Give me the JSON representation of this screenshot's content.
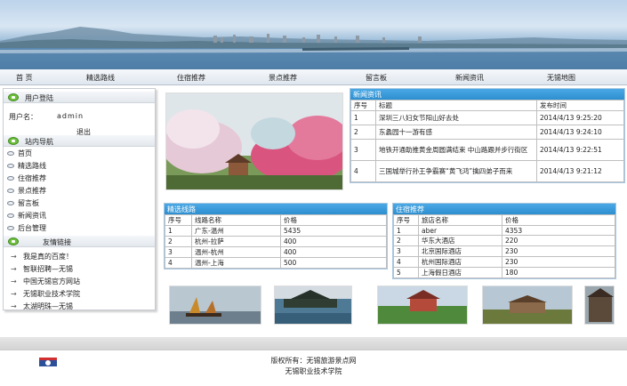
{
  "nav": [
    "首 页",
    "精选路线",
    "住宿推荐",
    "景点推荐",
    "留言板",
    "新闻资讯",
    "无锡地图"
  ],
  "sidebar": {
    "user_title": "用户登陆",
    "user_label": "用户名：",
    "user_name": "admin",
    "logout": "退出",
    "site_nav_title": "站内导航",
    "site_nav": [
      "首页",
      "精选路线",
      "住宿推荐",
      "景点推荐",
      "留言板",
      "新闻资讯",
      "后台管理"
    ],
    "links_title": "友情链接",
    "links": [
      "我是真的百度！",
      "智联招聘—无锡",
      "中国无锡官方网站",
      "无锡职业技术学院",
      "太湖明珠—无锡"
    ]
  },
  "news": {
    "title": "新闻资讯",
    "headers": [
      "序号",
      "标题",
      "发布时间"
    ],
    "rows": [
      [
        "1",
        "深圳三八妇女节阳山好去处",
        "2014/4/13 9:25:20"
      ],
      [
        "2",
        "东蠡园十一游有感",
        "2014/4/13 9:24:10"
      ],
      [
        "3",
        "地铁开通助推黄金周圆满结束 中山路跟并步行街区",
        "2014/4/13 9:22:51"
      ],
      [
        "4",
        "三国城举行孙王争霸赛“黄飞鸿”擒四弟子而来",
        "2014/4/13 9:21:12"
      ]
    ]
  },
  "routes": {
    "title": "精选线路",
    "headers": [
      "序号",
      "线路名称",
      "价格"
    ],
    "rows": [
      [
        "1",
        "广东-温州",
        "5435"
      ],
      [
        "2",
        "杭州-拉萨",
        "400"
      ],
      [
        "3",
        "温州-杭州",
        "400"
      ],
      [
        "4",
        "温州-上海",
        "500"
      ]
    ]
  },
  "hotels": {
    "title": "住宿推荐",
    "headers": [
      "序号",
      "旅店名称",
      "价格"
    ],
    "rows": [
      [
        "1",
        "aber",
        "4353"
      ],
      [
        "2",
        "华东大酒店",
        "220"
      ],
      [
        "3",
        "北京国际酒店",
        "230"
      ],
      [
        "4",
        "杭州国际酒店",
        "230"
      ],
      [
        "5",
        "上海假日酒店",
        "180"
      ]
    ]
  },
  "footer": {
    "line1": "版权所有：无锡旅游景点网",
    "line2": "无锡职业技术学院"
  },
  "colors": {
    "table_header": "#2d8fd0",
    "accent_green": "#6fbf3c"
  }
}
